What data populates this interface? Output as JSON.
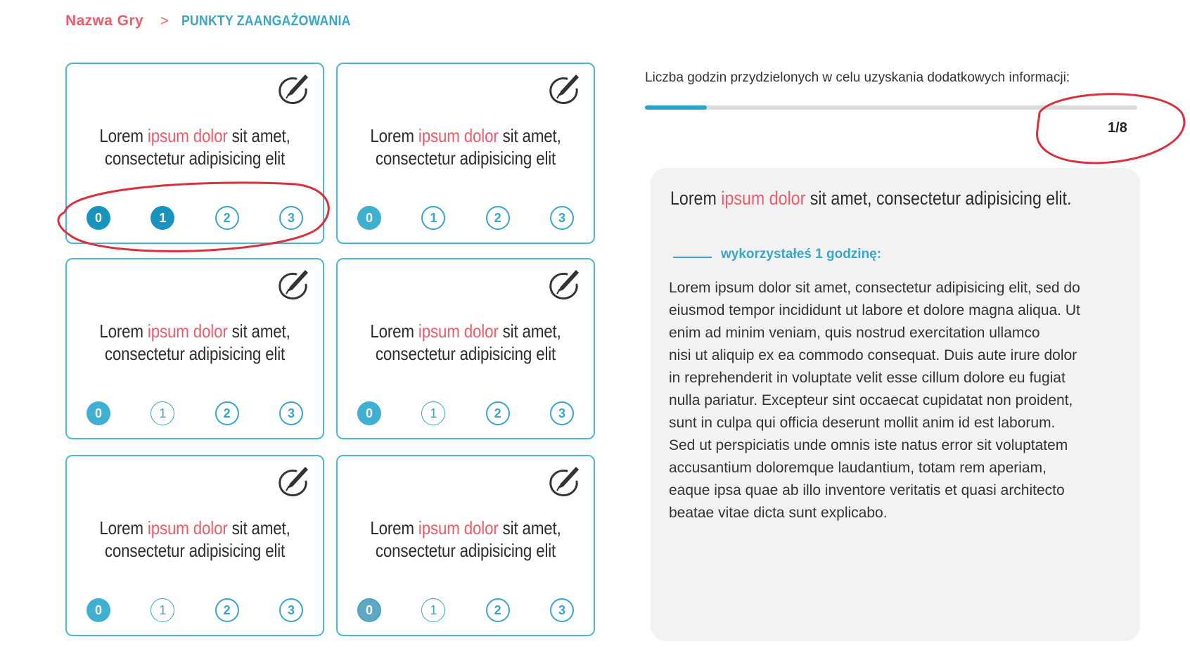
{
  "breadcrumb": {
    "game": "Nazwa Gry",
    "separator": ">",
    "current": "PUNKTY ZAANGAŻOWANIA"
  },
  "cards": [
    {
      "text_a": "Lorem ",
      "text_hl": "ipsum dolor",
      "text_b": " sit amet,",
      "text_c": "consectetur adipisicing elit",
      "icon": "pen-circle-icon",
      "options": [
        "0",
        "1",
        "2",
        "3"
      ],
      "selected": "1"
    },
    {
      "text_a": "Lorem ",
      "text_hl": "ipsum dolor",
      "text_b": " sit amet,",
      "text_c": "consectetur adipisicing elit",
      "icon": "pen-circle-icon",
      "options": [
        "0",
        "1",
        "2",
        "3"
      ],
      "selected": "0"
    },
    {
      "text_a": "Lorem ",
      "text_hl": "ipsum dolor",
      "text_b": " sit amet,",
      "text_c": "consectetur adipisicing elit",
      "icon": "pen-circle-icon",
      "options": [
        "0",
        "1",
        "2",
        "3"
      ],
      "selected": "0"
    },
    {
      "text_a": "Lorem ",
      "text_hl": "ipsum dolor",
      "text_b": " sit amet,",
      "text_c": "consectetur adipisicing elit",
      "icon": "pen-circle-icon",
      "options": [
        "0",
        "1",
        "2",
        "3"
      ],
      "selected": "0"
    },
    {
      "text_a": "Lorem ",
      "text_hl": "ipsum dolor",
      "text_b": " sit amet,",
      "text_c": "consectetur adipisicing elit",
      "icon": "pen-circle-icon",
      "options": [
        "0",
        "1",
        "2",
        "3"
      ],
      "selected": "0"
    },
    {
      "text_a": "Lorem ",
      "text_hl": "ipsum dolor",
      "text_b": " sit amet,",
      "text_c": "consectetur adipisicing elit",
      "icon": "pen-circle-icon",
      "options": [
        "0",
        "1",
        "2",
        "3"
      ],
      "selected": "0"
    }
  ],
  "hours": {
    "label": "Liczba godzin przydzielonych w celu uzyskania dodatkowych informacji:",
    "used": 1,
    "total": 8,
    "counter": "1/8"
  },
  "info": {
    "title_a": "Lorem ",
    "title_hl": "ipsum dolor",
    "title_b": " sit amet, consectetur adipisicing elit.",
    "used_label": "wykorzystałeś 1 godzinę:",
    "body_lines": [
      "Lorem ipsum dolor sit amet, consectetur adipisicing elit, sed do",
      "eiusmod tempor incididunt ut labore et dolore magna aliqua. Ut",
      "enim ad minim veniam, quis nostrud exercitation ullamco",
      "nisi ut aliquip ex ea commodo consequat. Duis aute irure dolor",
      "in reprehenderit in voluptate velit esse cillum dolore eu fugiat",
      "nulla pariatur. Excepteur sint occaecat cupidatat non proident,",
      "sunt in culpa qui officia deserunt mollit anim id est laborum.",
      "Sed ut perspiciatis unde omnis iste natus error sit voluptatem",
      "accusantium doloremque laudantium, totam rem aperiam,",
      "eaque ipsa quae ab illo inventore veritatis et quasi architecto",
      "beatae vitae dicta sunt explicabo."
    ]
  },
  "colors": {
    "accent_red": "#ea5d6d",
    "accent_blue": "#37a6c6",
    "annotation_red": "#d9303f"
  }
}
